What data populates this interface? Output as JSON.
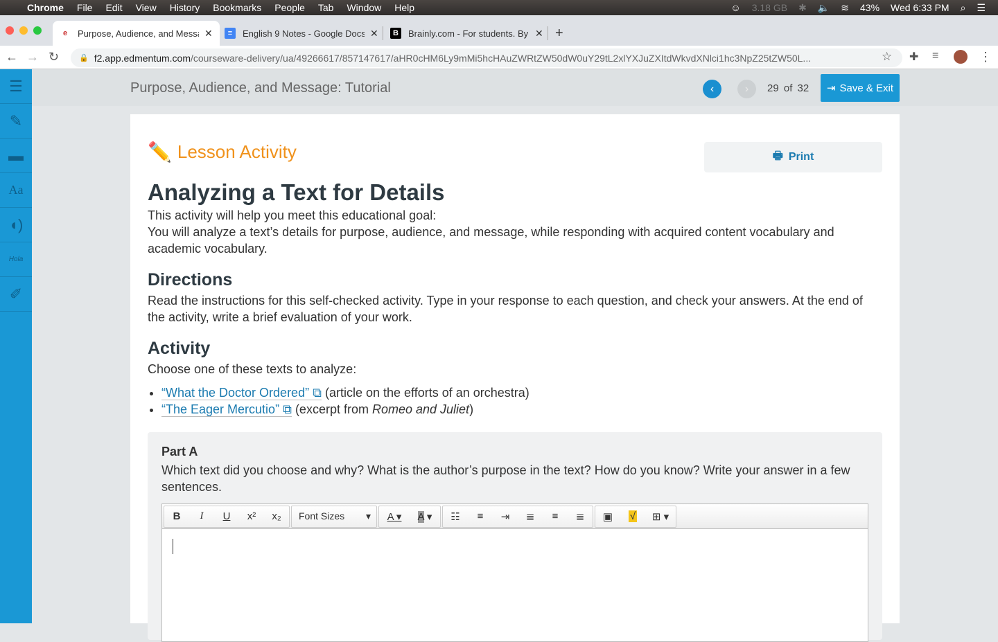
{
  "menubar": {
    "app": "Chrome",
    "items": [
      "File",
      "Edit",
      "View",
      "History",
      "Bookmarks",
      "People",
      "Tab",
      "Window",
      "Help"
    ],
    "memory": "3.18 GB",
    "battery": "43%",
    "clock": "Wed 6:33 PM"
  },
  "tabs": [
    {
      "title": "Purpose, Audience, and Message: Tutorial",
      "fav": "e"
    },
    {
      "title": "English 9 Notes - Google Docs",
      "fav": "≡"
    },
    {
      "title": "Brainly.com - For students. By students.",
      "fav": "B"
    }
  ],
  "address": {
    "host": "f2.app.edmentum.com",
    "path": "/courseware-delivery/ua/49266617/857147617/aHR0cHM6Ly9mMi5hcHAuZWRtZW50dW0uY29tL2xlYXJuZXItdWkvdXNlci1hc3NpZ25tZW50L..."
  },
  "header": {
    "title": "Purpose, Audience, and Message: Tutorial",
    "current": "29",
    "of": "of",
    "total": "32",
    "save_label": "Save & Exit"
  },
  "content": {
    "section_label": "Lesson Activity",
    "print_label": "Print",
    "title": "Analyzing a Text for Details",
    "goal_intro": "This activity will help you meet this educational goal:",
    "goal": "You will analyze a text’s details for purpose, audience, and message, while responding with acquired content vocabulary and academic vocabulary.",
    "directions_heading": "Directions",
    "directions": "Read the instructions for this self-checked activity. Type in your response to each question, and check your answers. At the end of the activity, write a brief evaluation of your work.",
    "activity_heading": "Activity",
    "choose": "Choose one of these texts to analyze:",
    "texts": [
      {
        "link": "“What the Doctor Ordered”",
        "desc": "(article on the efforts of an orchestra)"
      },
      {
        "link": "“The Eager Mercutio”",
        "desc_pre": "(excerpt from ",
        "desc_em": "Romeo and Juliet",
        "desc_post": ")"
      }
    ],
    "part_a": {
      "heading": "Part A",
      "question": "Which text did you choose and why? What is the author’s purpose in the text? How do you know? Write your answer in a few sentences.",
      "font_sizes": "Font Sizes"
    }
  }
}
